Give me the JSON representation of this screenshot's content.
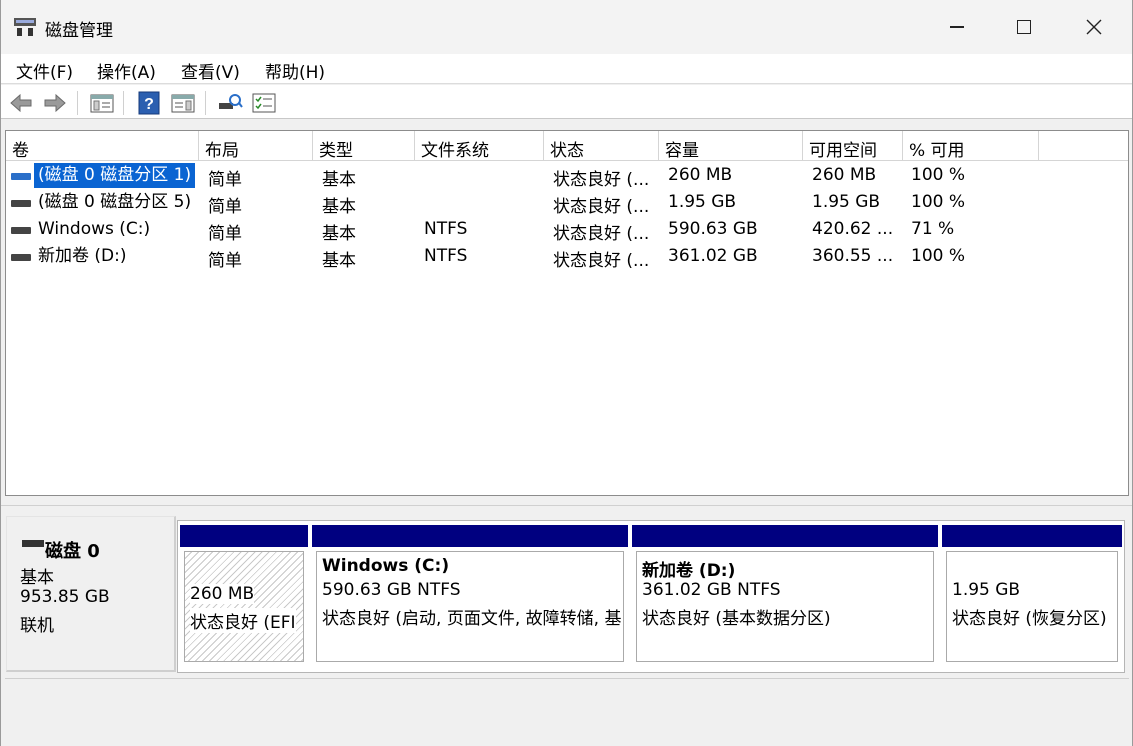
{
  "window": {
    "title": "磁盘管理",
    "icon": "disk-management-icon"
  },
  "menu": [
    {
      "label": "文件(F)"
    },
    {
      "label": "操作(A)"
    },
    {
      "label": "查看(V)"
    },
    {
      "label": "帮助(H)"
    }
  ],
  "toolbar": {
    "buttons": [
      "back-icon",
      "forward-icon",
      "console-tree-icon",
      "help-icon",
      "show-pane-icon",
      "connect-icon",
      "properties-icon"
    ]
  },
  "volume_list": {
    "columns": [
      "卷",
      "布局",
      "类型",
      "文件系统",
      "状态",
      "容量",
      "可用空间",
      "% 可用"
    ],
    "rows": [
      {
        "name": "(磁盘 0 磁盘分区 1)",
        "layout": "简单",
        "type": "基本",
        "fs": "",
        "status": "状态良好 (...",
        "capacity": "260 MB",
        "free": "260 MB",
        "pct": "100 %",
        "selected": true
      },
      {
        "name": "(磁盘 0 磁盘分区 5)",
        "layout": "简单",
        "type": "基本",
        "fs": "",
        "status": "状态良好 (...",
        "capacity": "1.95 GB",
        "free": "1.95 GB",
        "pct": "100 %",
        "selected": false
      },
      {
        "name": "Windows (C:)",
        "layout": "简单",
        "type": "基本",
        "fs": "NTFS",
        "status": "状态良好 (...",
        "capacity": "590.63 GB",
        "free": "420.62 ...",
        "pct": "71 %",
        "selected": false
      },
      {
        "name": "新加卷 (D:)",
        "layout": "简单",
        "type": "基本",
        "fs": "NTFS",
        "status": "状态良好 (...",
        "capacity": "361.02 GB",
        "free": "360.55 ...",
        "pct": "100 %",
        "selected": false
      }
    ]
  },
  "disk": {
    "title": "磁盘 0",
    "type": "基本",
    "size": "953.85 GB",
    "state": "联机",
    "partitions": [
      {
        "title": "",
        "line1": "260 MB",
        "line2": "状态良好 (EFI"
      },
      {
        "title": "Windows  (C:)",
        "line1": "590.63 GB NTFS",
        "line2": "状态良好 (启动, 页面文件, 故障转储, 基"
      },
      {
        "title": "新加卷  (D:)",
        "line1": "361.02 GB NTFS",
        "line2": "状态良好 (基本数据分区)"
      },
      {
        "title": "",
        "line1": "1.95 GB",
        "line2": "状态良好 (恢复分区)"
      }
    ]
  },
  "colors": {
    "partition_header": "#000080",
    "selection": "#0a64d2"
  }
}
